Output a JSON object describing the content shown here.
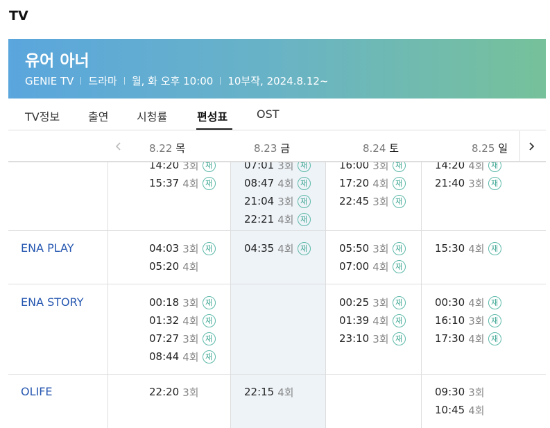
{
  "page_label": "TV",
  "show": {
    "title": "유어 아너",
    "meta": [
      "GENIE TV",
      "드라마",
      "월, 화 오후 10:00",
      "10부작, 2024.8.12~"
    ]
  },
  "tabs": [
    {
      "label": "TV정보",
      "active": false
    },
    {
      "label": "출연",
      "active": false
    },
    {
      "label": "시청률",
      "active": false
    },
    {
      "label": "편성표",
      "active": true
    },
    {
      "label": "OST",
      "active": false
    }
  ],
  "nav": {
    "prev_icon": "chevron-left-icon",
    "next_icon": "chevron-right-icon"
  },
  "dates": [
    {
      "date": "8.22",
      "weekday": "목"
    },
    {
      "date": "8.23",
      "weekday": "금"
    },
    {
      "date": "8.24",
      "weekday": "토"
    },
    {
      "date": "8.25",
      "weekday": "일"
    }
  ],
  "rerun_label": "재",
  "colors": {
    "channel_link": "#2657b0",
    "rerun_badge": "#3aa591",
    "highlight_column": "#eef3f8"
  },
  "partial_top_row": {
    "cells": [
      [
        {
          "time": "14:20",
          "ep": "3회",
          "rerun": true
        },
        {
          "time": "15:37",
          "ep": "4회",
          "rerun": true
        }
      ],
      [
        {
          "time": "07:01",
          "ep": "3회",
          "rerun": true
        },
        {
          "time": "08:47",
          "ep": "4회",
          "rerun": true
        },
        {
          "time": "21:04",
          "ep": "3회",
          "rerun": true
        },
        {
          "time": "22:21",
          "ep": "4회",
          "rerun": true
        }
      ],
      [
        {
          "time": "16:00",
          "ep": "3회",
          "rerun": true
        },
        {
          "time": "17:20",
          "ep": "4회",
          "rerun": true
        },
        {
          "time": "22:45",
          "ep": "3회",
          "rerun": true
        }
      ],
      [
        {
          "time": "14:20",
          "ep": "4회",
          "rerun": true
        },
        {
          "time": "21:40",
          "ep": "3회",
          "rerun": true
        }
      ]
    ]
  },
  "channels": [
    {
      "name": "ENA PLAY",
      "cells": [
        [
          {
            "time": "04:03",
            "ep": "3회",
            "rerun": true
          },
          {
            "time": "05:20",
            "ep": "4회",
            "rerun": false
          }
        ],
        [
          {
            "time": "04:35",
            "ep": "4회",
            "rerun": true
          }
        ],
        [
          {
            "time": "05:50",
            "ep": "3회",
            "rerun": true
          },
          {
            "time": "07:00",
            "ep": "4회",
            "rerun": true
          }
        ],
        [
          {
            "time": "15:30",
            "ep": "4회",
            "rerun": true
          }
        ]
      ]
    },
    {
      "name": "ENA STORY",
      "cells": [
        [
          {
            "time": "00:18",
            "ep": "3회",
            "rerun": true
          },
          {
            "time": "01:32",
            "ep": "4회",
            "rerun": true
          },
          {
            "time": "07:27",
            "ep": "3회",
            "rerun": true
          },
          {
            "time": "08:44",
            "ep": "4회",
            "rerun": true
          }
        ],
        [],
        [
          {
            "time": "00:25",
            "ep": "3회",
            "rerun": true
          },
          {
            "time": "01:39",
            "ep": "4회",
            "rerun": true
          },
          {
            "time": "23:10",
            "ep": "3회",
            "rerun": true
          }
        ],
        [
          {
            "time": "00:30",
            "ep": "4회",
            "rerun": true
          },
          {
            "time": "16:10",
            "ep": "3회",
            "rerun": true
          },
          {
            "time": "17:30",
            "ep": "4회",
            "rerun": true
          }
        ]
      ]
    },
    {
      "name": "OLIFE",
      "cells": [
        [
          {
            "time": "22:20",
            "ep": "3회",
            "rerun": false
          }
        ],
        [
          {
            "time": "22:15",
            "ep": "4회",
            "rerun": false
          }
        ],
        [],
        [
          {
            "time": "09:30",
            "ep": "3회",
            "rerun": false
          },
          {
            "time": "10:45",
            "ep": "4회",
            "rerun": false
          }
        ]
      ]
    }
  ]
}
